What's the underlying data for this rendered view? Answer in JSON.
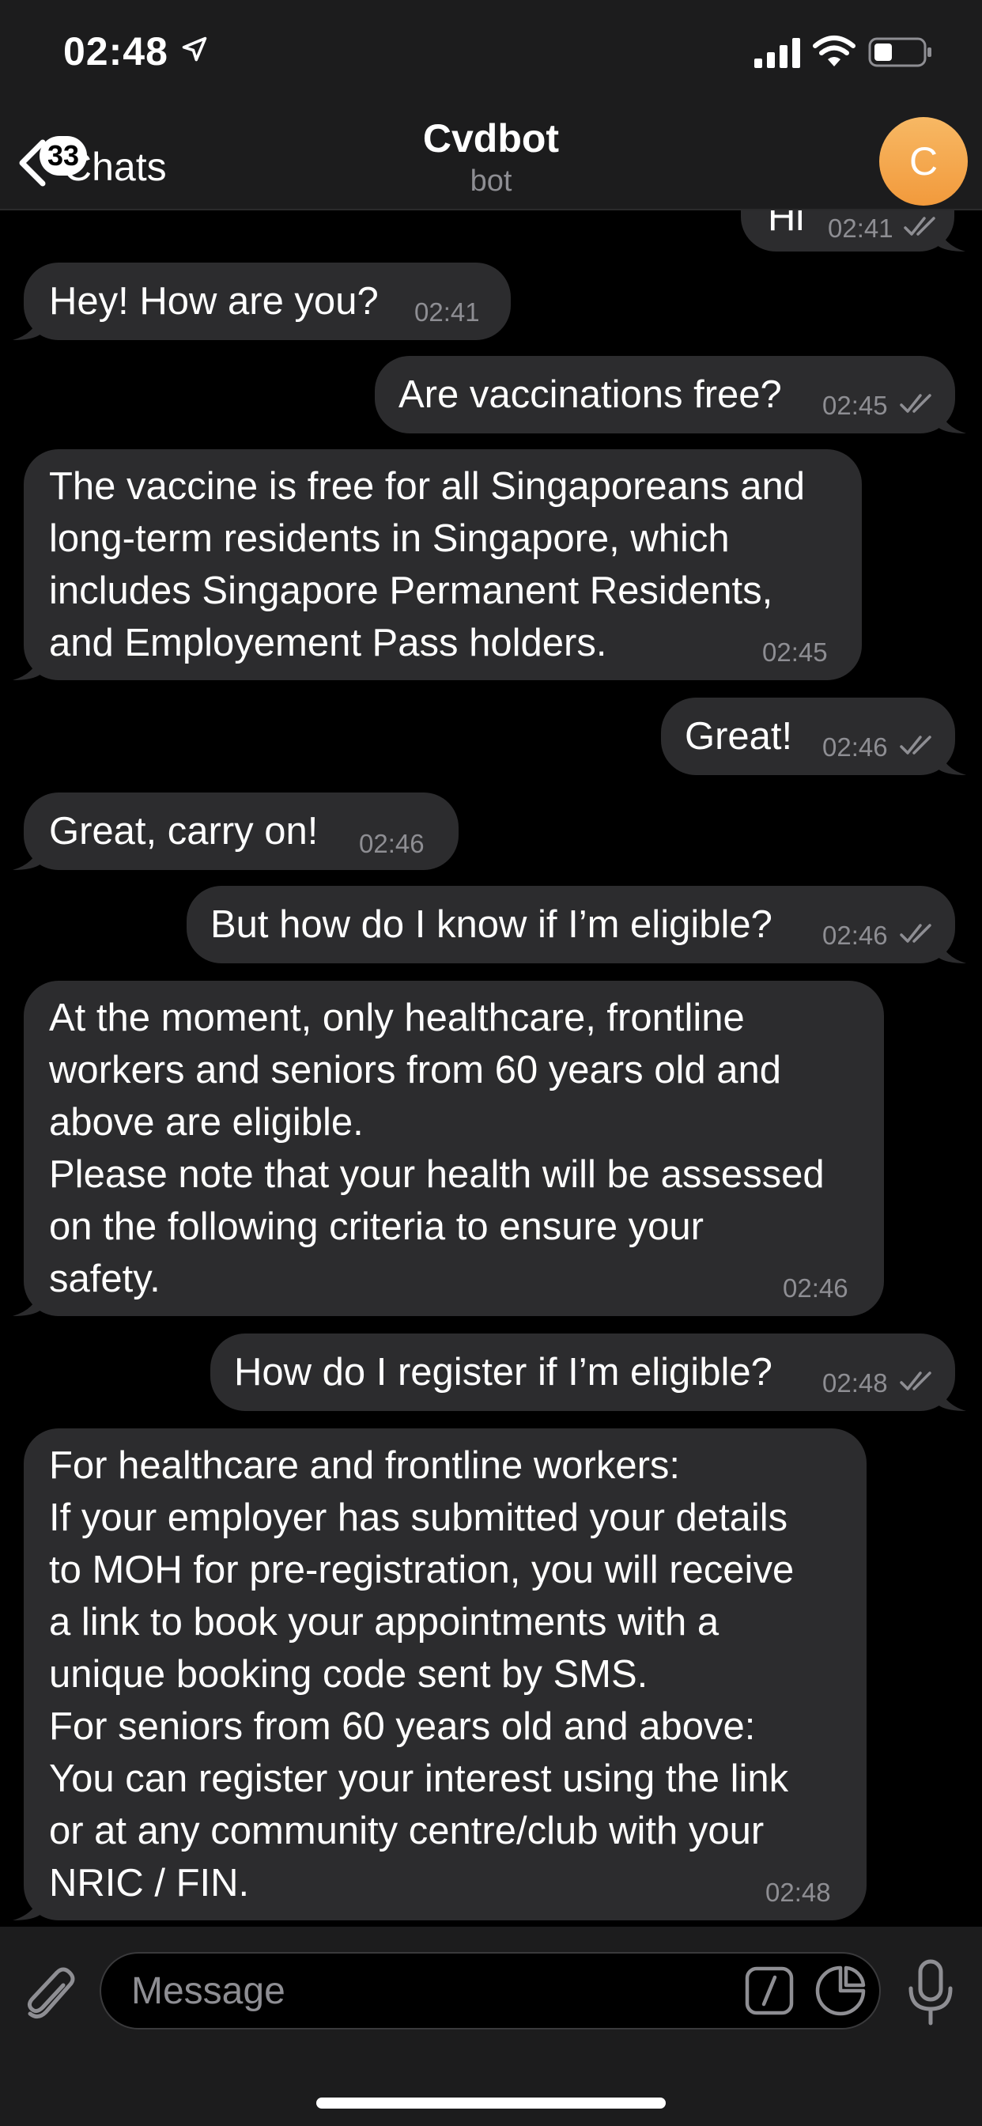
{
  "status_bar": {
    "time": "02:48"
  },
  "nav": {
    "back_label": "Chats",
    "unread_badge": "33",
    "title": "Cvdbot",
    "subtitle": "bot",
    "avatar_initial": "C"
  },
  "messages": [
    {
      "direction": "out",
      "text": "Hi",
      "time": "02:41",
      "read": true
    },
    {
      "direction": "in",
      "text": "Hey! How are you?",
      "time": "02:41"
    },
    {
      "direction": "out",
      "text": "Are vaccinations free?",
      "time": "02:45",
      "read": true
    },
    {
      "direction": "in",
      "text": "The vaccine is free for all Singaporeans and\nlong-term residents in Singapore, which\nincludes Singapore Permanent Residents,\nand Employement Pass holders.",
      "time": "02:45"
    },
    {
      "direction": "out",
      "text": "Great!",
      "time": "02:46",
      "read": true
    },
    {
      "direction": "in",
      "text": "Great, carry on!",
      "time": "02:46"
    },
    {
      "direction": "out",
      "text": "But how do I know if I’m eligible?",
      "time": "02:46",
      "read": true
    },
    {
      "direction": "in",
      "text": "At the moment, only healthcare, frontline\nworkers and seniors from 60 years old and\nabove are eligible.\nPlease note that your health will be assessed\non the following criteria to ensure your\nsafety.",
      "time": "02:46"
    },
    {
      "direction": "out",
      "text": "How do I register if I’m eligible?",
      "time": "02:48",
      "read": true
    },
    {
      "direction": "in",
      "text": "For healthcare and frontline workers:\nIf your employer has submitted your details\nto MOH for pre-registration, you will receive\na link to book your appointments with a\nunique booking code sent by SMS.\nFor seniors from 60 years old and above:\nYou can register your interest using the link\nor at any community centre/club with your\nNRIC / FIN.",
      "time": "02:48"
    }
  ],
  "input": {
    "placeholder": "Message"
  },
  "colors": {
    "bubble": "#2c2c2e",
    "background": "#000000",
    "bar": "#1c1c1d",
    "avatar": "#f2a14a",
    "timestamp": "#8e8e93"
  },
  "icons": [
    "location-arrow-icon",
    "signal-icon",
    "wifi-icon",
    "battery-icon",
    "chevron-left-icon",
    "double-check-icon",
    "paperclip-icon",
    "command-icon",
    "sticker-icon",
    "microphone-icon"
  ]
}
